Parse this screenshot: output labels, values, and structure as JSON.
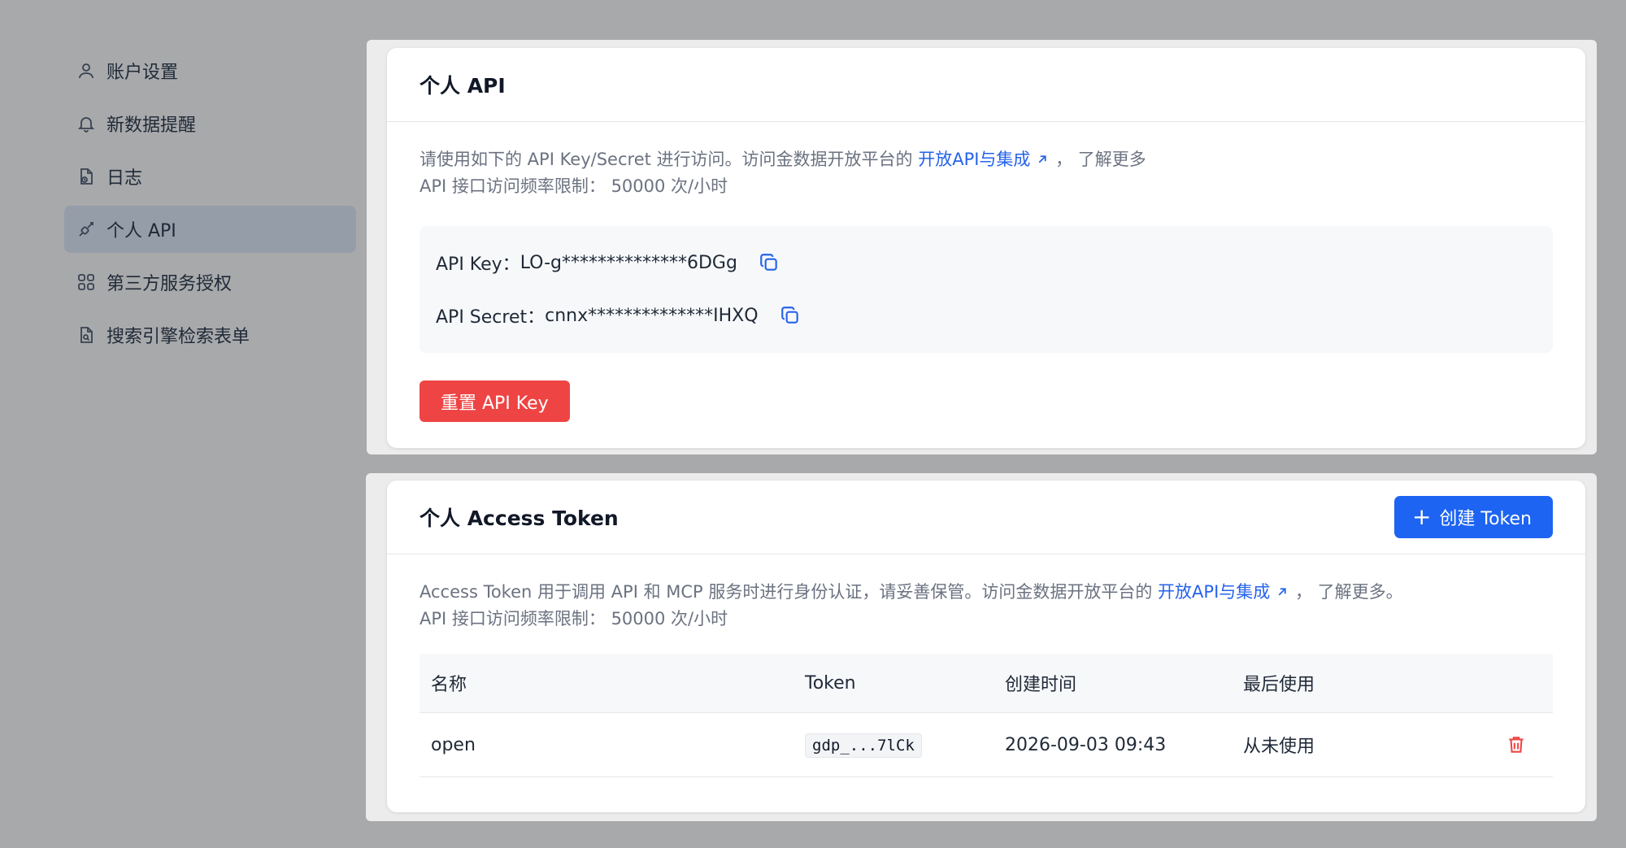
{
  "sidebar": {
    "items": [
      {
        "label": "账户设置",
        "icon": "user-icon"
      },
      {
        "label": "新数据提醒",
        "icon": "bell-icon"
      },
      {
        "label": "日志",
        "icon": "log-file-icon"
      },
      {
        "label": "个人 API",
        "icon": "api-plug-icon",
        "active": true
      },
      {
        "label": "第三方服务授权",
        "icon": "grid-apps-icon"
      },
      {
        "label": "搜索引擎检索表单",
        "icon": "search-file-icon"
      }
    ]
  },
  "api_card": {
    "title": "个人 API",
    "desc_prefix": "请使用如下的 API Key/Secret 进行访问。访问金数据开放平台的 ",
    "desc_link": "开放API与集成",
    "desc_suffix": " ， 了解更多",
    "rate_limit": "API 接口访问频率限制： 50000 次/小时",
    "api_key_label": "API Key：",
    "api_key_value": "LO-g**************6DGg",
    "api_secret_label": "API Secret：",
    "api_secret_value": "cnnx**************IHXQ",
    "reset_button": "重置 API Key"
  },
  "token_card": {
    "title": "个人 Access Token",
    "create_button": "创建 Token",
    "desc_prefix": "Access Token 用于调用 API 和 MCP 服务时进行身份认证，请妥善保管。访问金数据开放平台的 ",
    "desc_link": "开放API与集成",
    "desc_suffix": " ， 了解更多。",
    "rate_limit": "API 接口访问频率限制： 50000 次/小时",
    "table": {
      "headers": [
        "名称",
        "Token",
        "创建时间",
        "最后使用"
      ],
      "rows": [
        {
          "name": "open",
          "token": "gdp_...7lCk",
          "created": "2026-09-03 09:43",
          "last_used": "从未使用"
        }
      ]
    }
  },
  "colors": {
    "accent": "#1d64f2",
    "danger": "#ef4444",
    "link": "#2563eb"
  }
}
